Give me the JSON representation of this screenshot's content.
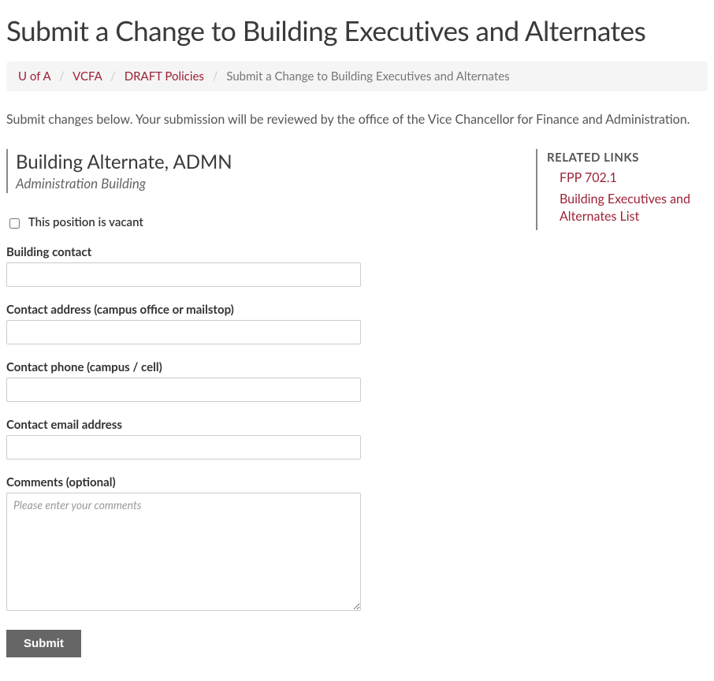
{
  "page_title": "Submit a Change to Building Executives and Alternates",
  "breadcrumb": {
    "items": [
      {
        "label": "U of A",
        "link": true
      },
      {
        "label": "VCFA",
        "link": true
      },
      {
        "label": "DRAFT Policies",
        "link": true
      },
      {
        "label": "Submit a Change to Building Executives and Alternates",
        "link": false
      }
    ],
    "separator": "/"
  },
  "intro_text": "Submit changes below. Your submission will be reviewed by the office of the Vice Chancellor for Finance and Administration.",
  "position": {
    "title": "Building Alternate, ADMN",
    "subtitle": "Administration Building"
  },
  "form": {
    "vacant_checkbox_label": "This position is vacant",
    "vacant_checked": false,
    "fields": {
      "building_contact": {
        "label": "Building contact",
        "value": ""
      },
      "contact_address": {
        "label": "Contact address (campus office or mailstop)",
        "value": ""
      },
      "contact_phone": {
        "label": "Contact phone (campus / cell)",
        "value": ""
      },
      "contact_email": {
        "label": "Contact email address",
        "value": ""
      },
      "comments": {
        "label": "Comments (optional)",
        "value": "",
        "placeholder": "Please enter your comments"
      }
    },
    "submit_label": "Submit"
  },
  "related": {
    "heading": "RELATED LINKS",
    "links": [
      "FPP 702.1",
      "Building Executives and Alternates List"
    ]
  }
}
